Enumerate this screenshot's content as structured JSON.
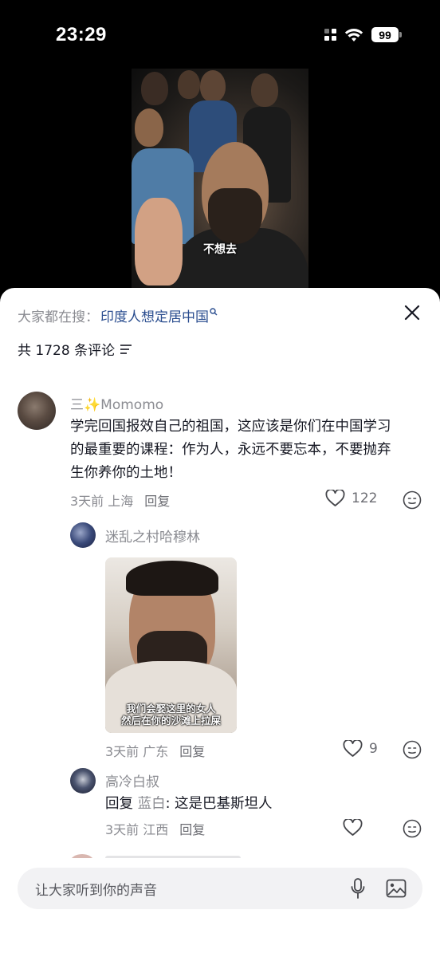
{
  "status_bar": {
    "time": "23:29",
    "battery": "99"
  },
  "video": {
    "subtitle": "不想去"
  },
  "sheet": {
    "search_prefix": "大家都在搜：",
    "search_keyword": "印度人想定居中国",
    "count_text": "共 1728 条评论"
  },
  "comments": [
    {
      "name": "三✨Momomo",
      "text_lines": [
        "学完回国报效自己的祖国，这应该是你们在中国学习",
        "的最重要的课程：作为人，永远不要忘本，不要抛弃",
        "生你养你的土地！"
      ],
      "time": "3天前",
      "location": "上海",
      "reply_label": "回复",
      "likes": "122"
    },
    {
      "name": "迷乱之村哈穆林",
      "image_caption_lines": [
        "我们会娶这里的女人",
        "然后在你的沙滩上拉屎"
      ],
      "time": "3天前",
      "location": "广东",
      "reply_label": "回复",
      "likes": "9"
    },
    {
      "name": "高冷白叔",
      "reply_prefix": "回复",
      "reply_target": "蓝白",
      "text": ": 这是巴基斯坦人",
      "time": "3天前",
      "location": "江西",
      "reply_label": "回复"
    }
  ],
  "input": {
    "placeholder": "让大家听到你的声音"
  },
  "icons": [
    "signal-icon",
    "wifi-icon",
    "battery-icon",
    "close-icon",
    "filter-icon",
    "heart-icon",
    "emoji-icon",
    "mic-icon",
    "image-icon",
    "search-icon"
  ],
  "colors": {
    "keyword_blue": "#2a4d8f",
    "secondary_gray": "#8a8b91",
    "text_dark": "#161823"
  }
}
